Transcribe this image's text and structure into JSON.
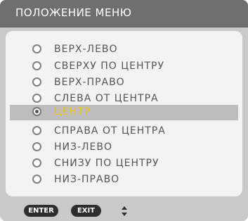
{
  "dialog": {
    "title": "ПОЛОЖЕНИЕ МЕНЮ"
  },
  "menu": {
    "items": [
      {
        "label": "ВЕРХ-ЛЕВО",
        "selected": false
      },
      {
        "label": "СВЕРХУ ПО ЦЕНТРУ",
        "selected": false
      },
      {
        "label": "ВЕРХ-ПРАВО",
        "selected": false
      },
      {
        "label": "СЛЕВА ОТ ЦЕНТРА",
        "selected": false
      },
      {
        "label": "ЦЕНТР",
        "selected": true
      },
      {
        "label": "СПРАВА ОТ ЦЕНТРА",
        "selected": false
      },
      {
        "label": "НИЗ-ЛЕВО",
        "selected": false
      },
      {
        "label": "СНИЗУ ПО ЦЕНТРУ",
        "selected": false
      },
      {
        "label": "НИЗ-ПРАВО",
        "selected": false
      }
    ]
  },
  "footer": {
    "enter_label": "ENTER",
    "exit_label": "EXIT",
    "nav_icon": "up-down-arrows-icon"
  },
  "colors": {
    "title_bar": "#6f6f6f",
    "background": "#c9c9c9",
    "panel": "#f3f3f3",
    "selected_row": "#bdbdbd",
    "selected_text": "#e6c21a",
    "item_text": "#555555"
  }
}
